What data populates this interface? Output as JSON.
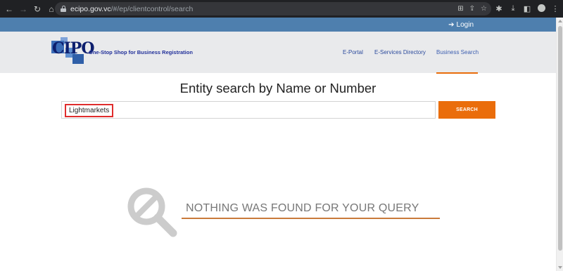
{
  "browser": {
    "url_host": "ecipo.gov.vc",
    "url_path": "/#/ep/clientcontrol/search"
  },
  "topbar": {
    "login_label": "Login"
  },
  "header": {
    "logo_tagline": "One-Stop Shop for Business Registration",
    "logo_letters": "CIPO",
    "nav": [
      {
        "label": "E-Portal"
      },
      {
        "label": "E-Services Directory"
      },
      {
        "label": "Business Search",
        "active": true
      }
    ],
    "accent_color": "#e96d0b"
  },
  "main": {
    "title": "Entity search by Name or Number",
    "search": {
      "value": "Lightmarkets",
      "button_label": "SEARCH"
    },
    "empty_message": "NOTHING WAS FOUND FOR YOUR QUERY"
  }
}
